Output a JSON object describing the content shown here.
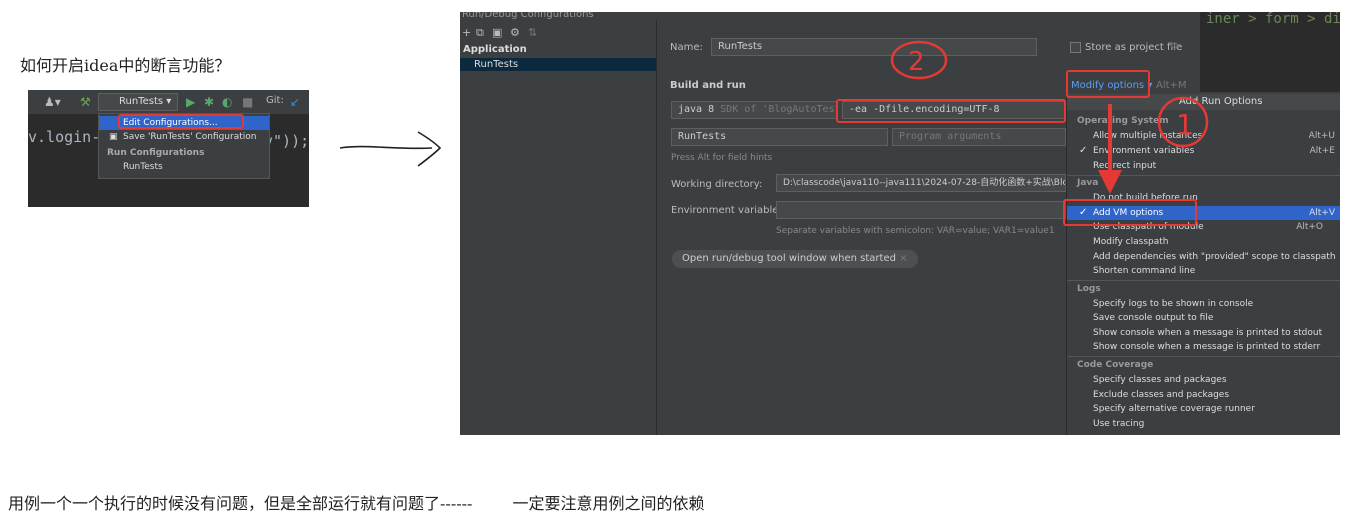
{
  "doc": {
    "question": "如何开启idea中的断言功能？",
    "note_left": "用例一个一个执行的时候没有问题，但是全部运行就有问题了------",
    "note_right": "一定要注意用例之间的依赖"
  },
  "mini_ide": {
    "run_selector": "RunTests",
    "git_label": "Git:",
    "code_left": "v.login-",
    "code_right": "v\"));",
    "menu": {
      "edit_configurations": "Edit Configurations...",
      "save_configuration": "Save 'RunTests' Configuration",
      "run_configurations_header": "Run Configurations",
      "run_tests": "RunTests"
    }
  },
  "dialog": {
    "title": "Run/Debug Configurations",
    "tree": {
      "group": "Application",
      "item": "RunTests"
    },
    "name_label": "Name:",
    "name_value": "RunTests",
    "store_label": "Store as project file",
    "build_and_run": "Build and run",
    "modify_options": "Modify options",
    "modify_shortcut": "Alt+M",
    "jdk": "java 8",
    "jdk_hint": "SDK of 'BlogAutoTest'",
    "vm_options": "-ea -Dfile.encoding=UTF-8",
    "main_class": "RunTests",
    "program_args_placeholder": "Program arguments",
    "press_alt": "Press Alt for field hints",
    "working_dir_label": "Working directory:",
    "working_dir_value": "D:\\classcode\\java110--java111\\2024-07-28-自动化函数+实战\\BlogAu",
    "env_label": "Environment variables:",
    "env_hint": "Separate variables with semicolon: VAR=value; VAR1=value1",
    "open_tool_window": "Open run/debug tool window when started",
    "editor_text": "iner > form > div\""
  },
  "dropdown": {
    "title": "Add Run Options",
    "groups": {
      "os": "Operating System",
      "java": "Java",
      "logs": "Logs",
      "coverage": "Code Coverage"
    },
    "items": {
      "allow_multiple": "Allow multiple instances",
      "allow_multiple_sc": "Alt+U",
      "env_vars": "Environment variables",
      "env_vars_sc": "Alt+E",
      "redirect_input": "Redirect input",
      "do_not_build": "Do not build before run",
      "add_vm": "Add VM options",
      "add_vm_sc": "Alt+V",
      "use_classpath": "Use classpath of module",
      "use_classpath_sc": "Alt+O",
      "modify_classpath": "Modify classpath",
      "add_deps": "Add dependencies with \"provided\" scope to classpath",
      "shorten_cmd": "Shorten command line",
      "specify_logs": "Specify logs to be shown in console",
      "save_console": "Save console output to file",
      "show_stdout": "Show console when a message is printed to stdout",
      "show_stderr": "Show console when a message is printed to stderr",
      "specify_classes": "Specify classes and packages",
      "exclude_classes": "Exclude classes and packages",
      "specify_runner": "Specify alternative coverage runner",
      "use_tracing": "Use tracing"
    }
  },
  "annotations": {
    "digit_two": "2",
    "digit_one": "1"
  }
}
